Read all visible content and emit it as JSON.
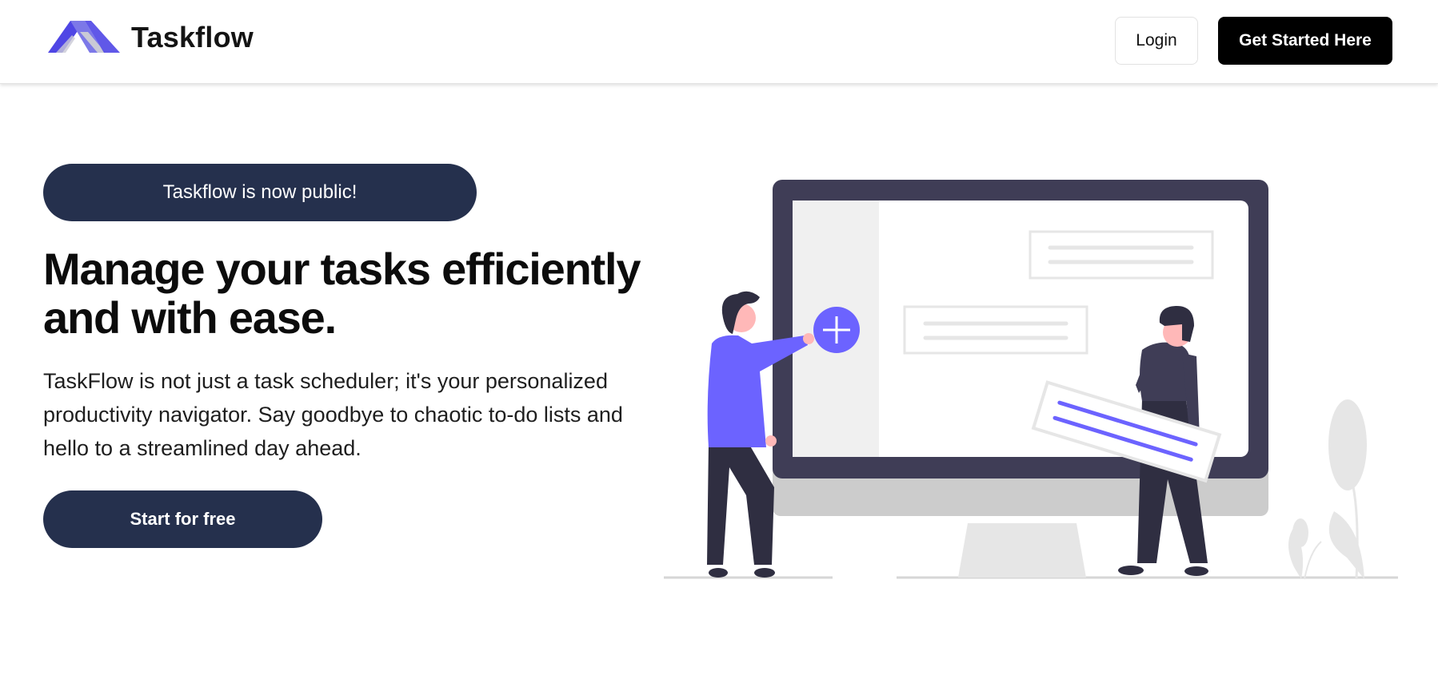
{
  "header": {
    "brand_name": "Taskflow",
    "logo_icon": "taskflow-logo",
    "login_label": "Login",
    "get_started_label": "Get Started Here"
  },
  "hero": {
    "badge_text": "Taskflow is now public!",
    "headline": "Manage your tasks efficiently and with ease.",
    "subtext": "TaskFlow is not just a task scheduler; it's your personalized productivity navigator. Say goodbye to chaotic to-do lists and hello to a streamlined day ahead.",
    "cta_label": "Start for free"
  },
  "illustration": {
    "icon": "task-board-illustration",
    "plus_icon": "plus-icon"
  },
  "colors": {
    "accent": "#6c63ff",
    "navy": "#25304d",
    "monitor": "#3f3d56",
    "black": "#000000"
  }
}
